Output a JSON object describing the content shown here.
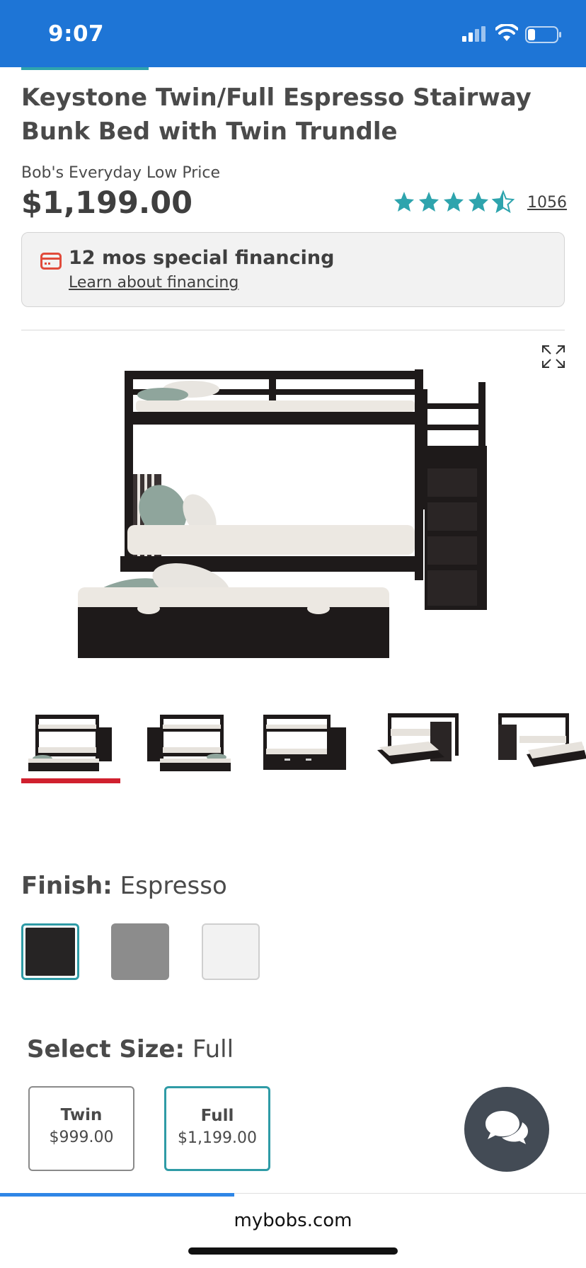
{
  "status_bar": {
    "time": "9:07",
    "icons": [
      "signal-icon",
      "wifi-icon",
      "battery-icon"
    ],
    "background": "#1e75d6"
  },
  "product": {
    "title": "Keystone Twin/Full Espresso Stairway Bunk Bed with Twin Trundle",
    "price_label": "Bob's Everyday Low Price",
    "price": "$1,199.00",
    "rating_stars": 4.5,
    "review_count": "1056"
  },
  "financing": {
    "title": "12 mos special financing",
    "link": "Learn about financing",
    "icon": "credit-card-icon"
  },
  "gallery": {
    "thumbnail_count": 5,
    "selected_index": 0,
    "expand_icon": "expand-icon"
  },
  "finish": {
    "label": "Finish:",
    "value": "Espresso",
    "swatches": [
      {
        "color": "#262424",
        "selected": true
      },
      {
        "color": "#8c8c8c",
        "selected": false
      },
      {
        "color": "#f2f2f2",
        "selected": false
      }
    ]
  },
  "size": {
    "label": "Select Size:",
    "value": "Full",
    "options": [
      {
        "name": "Twin",
        "price": "$999.00",
        "selected": false
      },
      {
        "name": "Full",
        "price": "$1,199.00",
        "selected": true
      }
    ]
  },
  "browser": {
    "url": "mybobs.com"
  },
  "colors": {
    "accent_teal": "#2f9ba6",
    "star": "#2ea4ad",
    "selected_underline": "#d0202e",
    "financing_icon": "#e14b3b",
    "chat_button": "#434b55"
  }
}
